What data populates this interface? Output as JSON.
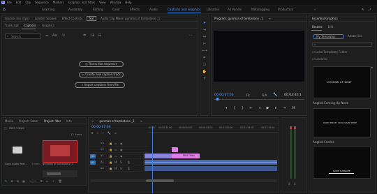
{
  "menu": {
    "items": [
      "File",
      "Edit",
      "Clip",
      "Sequence",
      "Markers",
      "Graphics and Titles",
      "View",
      "Window",
      "Help"
    ]
  },
  "workspaces": [
    "Learning",
    "Assembly",
    "Editing",
    "Color",
    "Effects",
    "Audio",
    "Captions and Graphics",
    "Libraries",
    "All Panels",
    "Metalogging",
    "Production"
  ],
  "source_panel": {
    "tabs": [
      "Source: (no clips)",
      "Lumetri Scopes",
      "Effect Controls",
      "Text",
      "Audio Clip Mixer: gunman of tombstone _1"
    ],
    "subtabs": [
      "Transcript",
      "Captions",
      "Graphics"
    ],
    "search_placeholder": "Search",
    "buttons": [
      "Transcribe sequence",
      "Create new caption track",
      "Import captions from file"
    ]
  },
  "program": {
    "title": "Program: gunman of tombstone _1",
    "timecode": "00:00:07:00",
    "fit": "Fit",
    "quality": "Full",
    "duration": "00:02:42:1"
  },
  "essential_graphics": {
    "title": "Essential Graphics",
    "tabs": [
      "Browse",
      "Edit"
    ],
    "dropdown": "My Templates",
    "adobe_label": "Adobe Sto",
    "checkbox_local": "Local Templates Folder",
    "checkbox_libraries": "Libraries",
    "templates": [
      {
        "name": "Angled Coming Up Next",
        "preview": "COMING UP NEXT"
      },
      {
        "name": "Angled Credits",
        "preview": "DIRECTED BY YOUR NAME HERE"
      },
      {
        "name": "",
        "preview": "NAME SURNAME"
      }
    ]
  },
  "project": {
    "tabs": [
      "Media",
      "Project: Saber",
      "Project: Wor",
      "Info"
    ],
    "search_placeholder": "item views",
    "count": "12 items",
    "items": [
      {
        "label": "Dock Audio Red...",
        "meta": "1 item"
      },
      {
        "label": "gunman of tombstone_1",
        "meta": "1:09"
      }
    ]
  },
  "timeline": {
    "title": "gunman of tombstone _1",
    "timecode": "00:00:07:00",
    "ruler": [
      ":00:00",
      "00:00:15:00",
      "00:00:30:00",
      "00:00:45:00",
      "00:01:00:00",
      "00:01:15:00",
      "00:01:30:00"
    ],
    "tracks": [
      "V3",
      "V2",
      "V1",
      "A1",
      "A2"
    ],
    "clip_title": "FREE Tribu"
  },
  "colors": {
    "accent": "#3d7dde",
    "clip_pink": "#e07ee8",
    "clip_purple": "#8a84d9",
    "clip_blue": "#4a6ab0",
    "audio_green": "#2b9a3a"
  }
}
